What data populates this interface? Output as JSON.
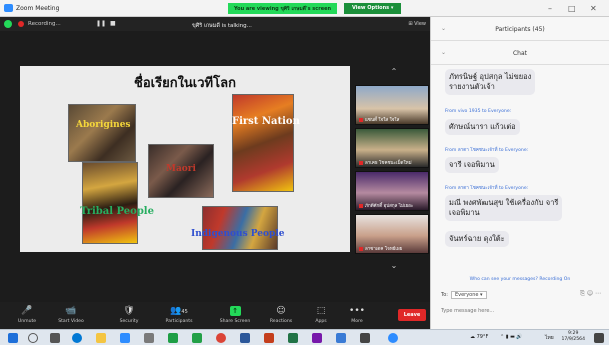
{
  "window": {
    "title": "Zoom Meeting"
  },
  "banner": {
    "viewing": "You are viewing ขุศิริ เกษมดี's screen",
    "view_options": "View Options ▾"
  },
  "meeting_top": {
    "recording": "Recording...",
    "pause": "❚❚",
    "stop": "■",
    "talking": "ขุศิริ เกษมดี is talking...",
    "view": "View"
  },
  "slide": {
    "title": "ชื่อเรียกในเวทีโลก",
    "labels": [
      "Aborigines",
      "Maori",
      "First Nation",
      "Tribal People",
      "Indigenous People"
    ]
  },
  "gallery": [
    {
      "name": "แซนดี้ ใจใส ใจใส"
    },
    {
      "name": "ลาเคธ โชคชนะเม็ดใหม่"
    },
    {
      "name": "ภักดีศักดิ์ อุปสกุล ไม่เยอะ"
    },
    {
      "name": "ลาซาเดค โจทย์เผย"
    }
  ],
  "toolbar": {
    "buttons": [
      {
        "label": "Unmute",
        "icon": "🎤"
      },
      {
        "label": "Start Video",
        "icon": "📹"
      },
      {
        "label": "Security",
        "icon": "🛡"
      },
      {
        "label": "Participants",
        "icon": "👥",
        "count": "45"
      },
      {
        "label": "Share Screen",
        "icon": "↑"
      },
      {
        "label": "Reactions",
        "icon": "☺"
      },
      {
        "label": "Apps",
        "icon": "⬚"
      },
      {
        "label": "More",
        "icon": "•••"
      }
    ],
    "leave": "Leave"
  },
  "panel": {
    "participants": "Participants (45)",
    "chat": "Chat",
    "messages": [
      {
        "from": "",
        "text": "ภัทรนิษฐ์ อุปสกุล ไม่ขยอง\nรายงานตัวเจ้า"
      },
      {
        "from": "From vivo 1935 to Everyone:",
        "text": "ศักษณ์นารา แก้วเต่อ"
      },
      {
        "from": "From ลาดา โชคชนะเจ้าที่ to Everyone:",
        "text": "จารี เจอพิมาน"
      },
      {
        "from": "From ลาดา โชคชนะเจ้าที่ to Everyone:",
        "text": "มณี พงศพัฒนสุข ใช้เครื่องกับ จารี\nเจอพิมาน"
      },
      {
        "from": "",
        "text": "จันทร์ฉาย ดุงใต้ะ"
      }
    ],
    "who_can_see": "Who can see your messages? Recording On",
    "to_label": "To:",
    "to_value": "Everyone ▾",
    "input_placeholder": "Type message here..."
  },
  "taskbar": {
    "weather": "79°F",
    "lang": "ไทย",
    "time": "9:29",
    "date": "17/9/2564"
  }
}
